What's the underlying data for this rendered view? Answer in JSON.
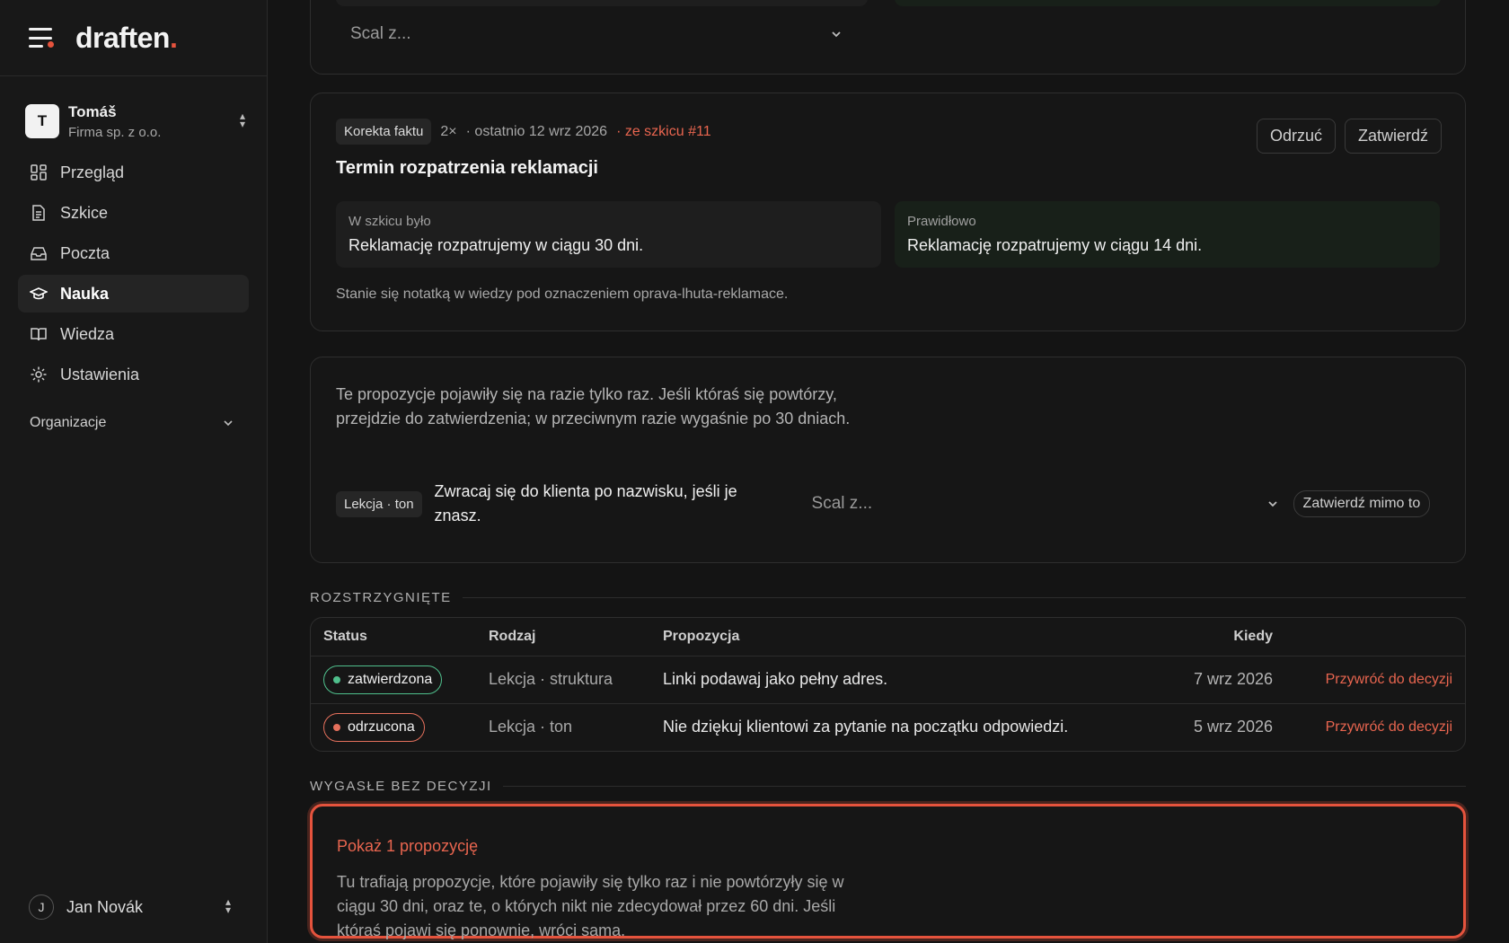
{
  "app": {
    "logo": "draften",
    "logo_dot": "."
  },
  "account": {
    "initial": "T",
    "name": "Tomáš",
    "company": "Firma sp. z o.o."
  },
  "nav": [
    {
      "label": "Przegląd",
      "icon": "grid-icon"
    },
    {
      "label": "Szkice",
      "icon": "document-icon"
    },
    {
      "label": "Poczta",
      "icon": "inbox-icon"
    },
    {
      "label": "Nauka",
      "icon": "graduation-cap-icon",
      "active": true
    },
    {
      "label": "Wiedza",
      "icon": "book-icon"
    },
    {
      "label": "Ustawienia",
      "icon": "gear-icon"
    }
  ],
  "organizations_label": "Organizacje",
  "user": {
    "initial": "J",
    "name": "Jan Novák"
  },
  "top_card": {
    "merge_placeholder": "Scal z..."
  },
  "correction": {
    "tag": "Korekta faktu",
    "count": "2×",
    "last": "· ostatnio 12 wrz 2026",
    "source": "· ze szkicu #11",
    "title": "Termin rozpatrzenia reklamacji",
    "reject": "Odrzuć",
    "approve": "Zatwierdź",
    "old_label": "W szkicu było",
    "old_value": "Reklamację rozpatrujemy w ciągu 30 dni.",
    "new_label": "Prawidłowo",
    "new_value": "Reklamację rozpatrujemy w ciągu 14 dni.",
    "note": "Stanie się notatką w wiedzy pod oznaczeniem oprava-lhuta-reklamace."
  },
  "single": {
    "intro": "Te propozycje pojawiły się na razie tylko raz. Jeśli któraś się powtórzy, przejdzie do zatwierdzenia; w przeciwnym razie wygaśnie po 30 dniach.",
    "tag": "Lekcja · ton",
    "text": "Zwracaj się do klienta po nazwisku, jeśli je znasz.",
    "merge_placeholder": "Scal z...",
    "approve_anyway": "Zatwierdź mimo to"
  },
  "resolved": {
    "title": "ROZSTRZYGNIĘTE",
    "columns": {
      "status": "Status",
      "kind": "Rodzaj",
      "proposal": "Propozycja",
      "when": "Kiedy"
    },
    "rows": [
      {
        "status": "zatwierdzona",
        "kind": "Lekcja · struktura",
        "proposal": "Linki podawaj jako pełny adres.",
        "when": "7 wrz 2026",
        "action": "Przywróć do decyzji"
      },
      {
        "status": "odrzucona",
        "kind": "Lekcja · ton",
        "proposal": "Nie dziękuj klientowi za pytanie na początku odpowiedzi.",
        "when": "5 wrz 2026",
        "action": "Przywróć do decyzji"
      }
    ]
  },
  "expired": {
    "title": "WYGASŁE BEZ DECYZJI",
    "show": "Pokaż 1 propozycję",
    "desc": "Tu trafiają propozycje, które pojawiły się tylko raz i nie powtórzyły się w ciągu 30 dni, oraz te, o których nikt nie zdecydował przez 60 dni. Jeśli któraś pojawi się ponownie, wróci sama."
  },
  "colors": {
    "accent": "#e5533d",
    "approved": "#4fbf8c",
    "rejected": "#e5705c"
  }
}
